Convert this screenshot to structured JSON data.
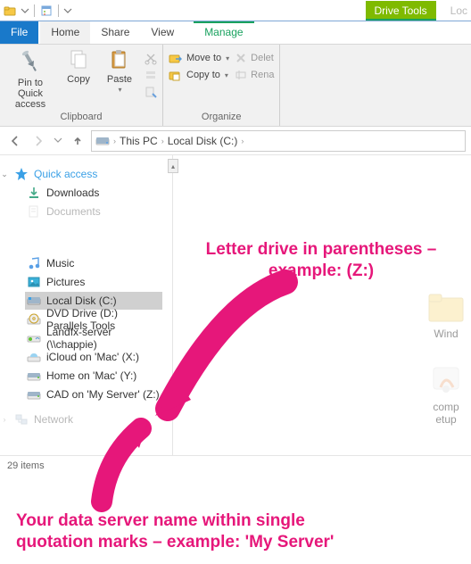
{
  "title_loc": "Loc",
  "contextual_label": "Drive Tools",
  "tabs": {
    "file": "File",
    "home": "Home",
    "share": "Share",
    "view": "View",
    "manage": "Manage"
  },
  "ribbon": {
    "clipboard": {
      "label": "Clipboard",
      "pin": "Pin to Quick\naccess",
      "copy": "Copy",
      "paste": "Paste"
    },
    "organize": {
      "label": "Organize",
      "moveto": "Move to",
      "copyto": "Copy to",
      "delete": "Delet",
      "rename": "Rena"
    }
  },
  "breadcrumb": {
    "root": "This PC",
    "item": "Local Disk (C:)"
  },
  "nav": {
    "quick": "Quick access",
    "downloads": "Downloads",
    "documents": "Documents",
    "music": "Music",
    "pictures": "Pictures",
    "localc": "Local Disk (C:)",
    "dvd": "DVD Drive (D:) Parallels Tools",
    "landfx": "Landfx-server (\\\\chappie)",
    "icloud": "iCloud on 'Mac' (X:)",
    "home": "Home on 'Mac' (Y:)",
    "cad": "CAD on 'My Server' (Z:)",
    "network": "Network"
  },
  "content": {
    "item1": "Wind",
    "item2a": "comp",
    "item2b": "etup"
  },
  "status": {
    "count": "29 items"
  },
  "annotations": {
    "a1": {
      "l1": "Letter drive in parentheses –",
      "l2": "example: (Z:)"
    },
    "a2": {
      "l1": "Your data server name within single",
      "l2": "quotation marks – example: 'My Server'"
    }
  }
}
